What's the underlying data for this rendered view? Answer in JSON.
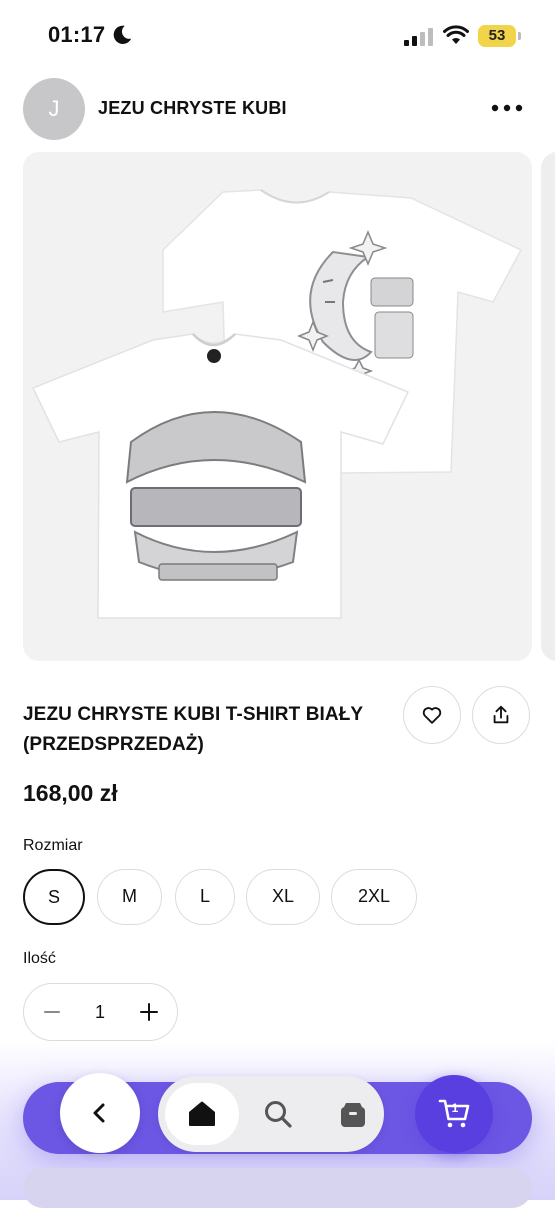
{
  "status_bar": {
    "time": "01:17",
    "battery": "53"
  },
  "header": {
    "avatar_letter": "J",
    "shop_name": "JEZU CHRYSTE KUBI"
  },
  "product": {
    "title": "JEZU CHRYSTE KUBI T-SHIRT BIAŁY (PRZEDSPRZEDAŻ)",
    "price": "168,00 zł",
    "size_label": "Rozmiar",
    "sizes": [
      "S",
      "M",
      "L",
      "XL",
      "2XL"
    ],
    "selected_size": "S",
    "quantity_label": "Ilość",
    "quantity": "1"
  },
  "cart": {
    "count": "1"
  },
  "colors": {
    "accent": "#6b57e4",
    "cart": "#5a3fe0",
    "battery": "#f2d44a"
  }
}
